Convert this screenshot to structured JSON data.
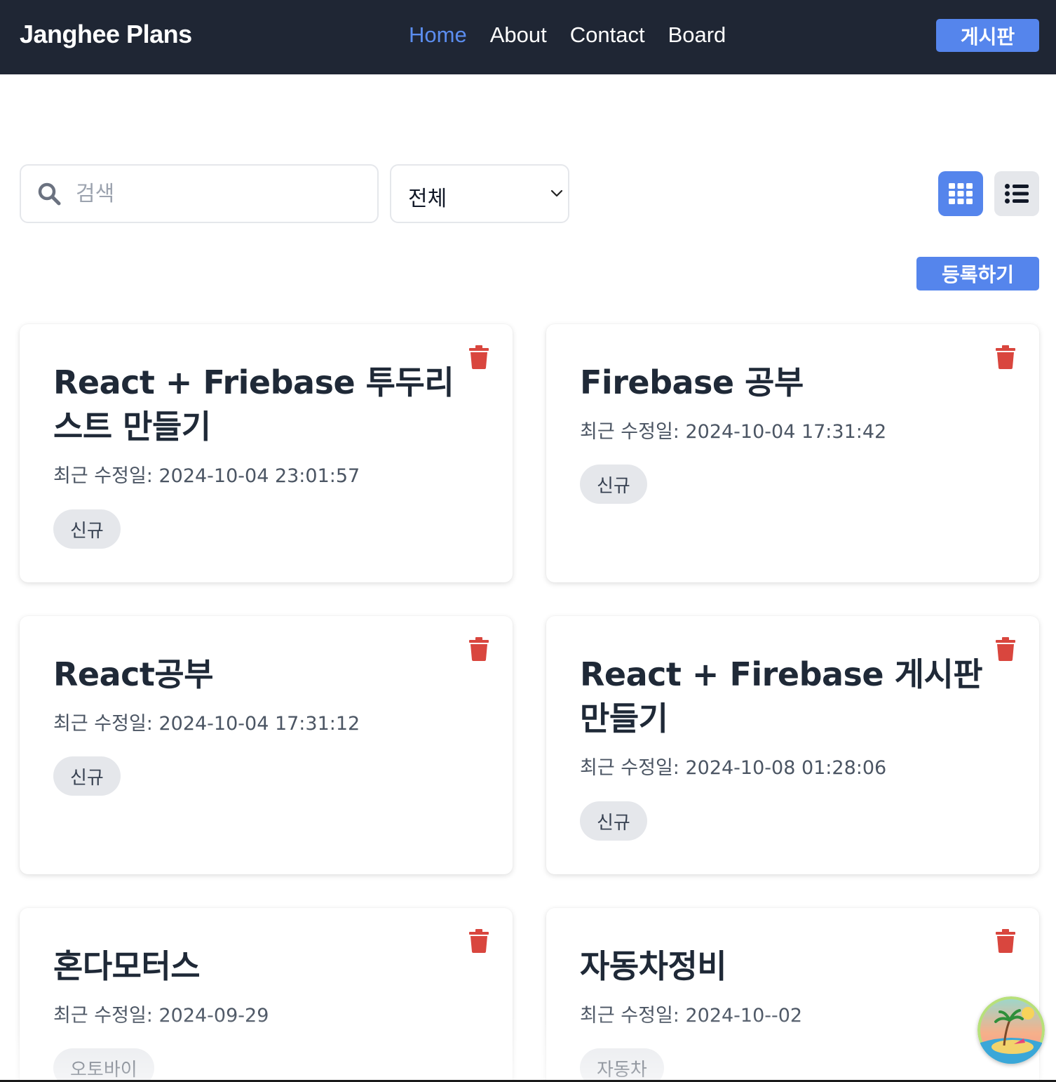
{
  "navbar": {
    "brand": "Janghee Plans",
    "links": [
      "Home",
      "About",
      "Contact",
      "Board"
    ],
    "active_link": "Home",
    "board_button": "게시판"
  },
  "toolbar": {
    "search_placeholder": "검색",
    "search_value": "",
    "filter_selected": "전체",
    "view_mode": "grid",
    "register_button": "등록하기"
  },
  "cards": [
    {
      "title": "React + Friebase 투두리스트 만들기",
      "date": "최근 수정일: 2024-10-04 23:01:57",
      "tag": "신규"
    },
    {
      "title": "Firebase 공부",
      "date": "최근 수정일: 2024-10-04 17:31:42",
      "tag": "신규"
    },
    {
      "title": "React공부",
      "date": "최근 수정일: 2024-10-04 17:31:12",
      "tag": "신규"
    },
    {
      "title": "React + Firebase 게시판 만들기",
      "date": "최근 수정일: 2024-10-08 01:28:06",
      "tag": "신규"
    },
    {
      "title": "혼다모터스",
      "date": "최근 수정일: 2024-09-29",
      "tag": "오토바이"
    },
    {
      "title": "자동차정비",
      "date": "최근 수정일: 2024-10--02",
      "tag": "자동차"
    }
  ],
  "colors": {
    "navbar_bg": "#1f2634",
    "accent": "#5585ec",
    "active_link": "#5b8def",
    "trash": "#d9463e",
    "tag_bg": "#e5e7eb"
  },
  "icons": {
    "search": "search-icon",
    "chevron": "chevron-down-icon",
    "grid": "grid-view-icon",
    "list": "list-view-icon",
    "trash": "trash-icon",
    "avatar": "beach-avatar"
  }
}
